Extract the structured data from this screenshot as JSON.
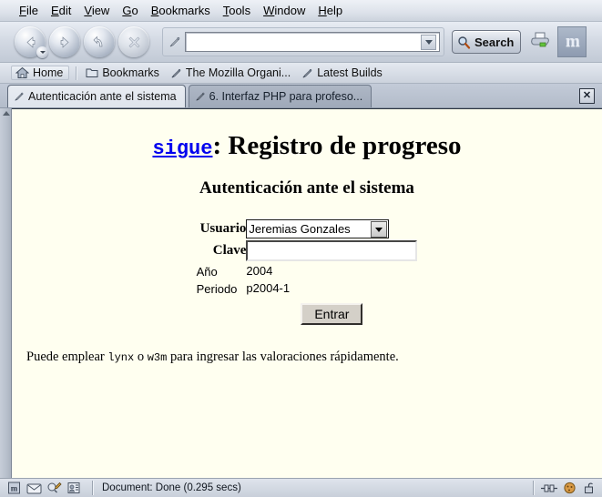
{
  "browser": {
    "menu": [
      {
        "mnemonic": "F",
        "rest": "ile"
      },
      {
        "mnemonic": "E",
        "rest": "dit"
      },
      {
        "mnemonic": "V",
        "rest": "iew"
      },
      {
        "mnemonic": "G",
        "rest": "o"
      },
      {
        "mnemonic": "B",
        "rest": "ookmarks"
      },
      {
        "mnemonic": "T",
        "rest": "ools"
      },
      {
        "mnemonic": "W",
        "rest": "indow"
      },
      {
        "mnemonic": "H",
        "rest": "elp"
      }
    ],
    "toolbar": {
      "back_label": "Back",
      "forward_label": "Forward",
      "reload_label": "Reload",
      "stop_label": "Stop",
      "url_value": "",
      "url_placeholder": "",
      "search_label": "Search",
      "print_label": "Print",
      "logo_label": "m"
    },
    "bookmarks_toolbar": [
      {
        "label": "Home",
        "icon": "home-icon"
      },
      {
        "label": "Bookmarks",
        "icon": "folder-icon"
      },
      {
        "label": "The Mozilla Organi...",
        "icon": "bookmark-icon"
      },
      {
        "label": "Latest Builds",
        "icon": "bookmark-icon"
      }
    ],
    "tabs": [
      {
        "label": "Autenticación ante el sistema",
        "active": true
      },
      {
        "label": "6. Interfaz PHP para profeso...",
        "active": false
      }
    ],
    "tab_close_label": "✕",
    "statusbar": {
      "document_status": "Document: Done (0.295 secs)",
      "component_icons": [
        "browser-icon",
        "mail-icon",
        "composer-icon",
        "addressbook-icon"
      ],
      "right_icons": [
        "connection-icon",
        "cookie-icon",
        "unlocked-padlock-icon"
      ]
    }
  },
  "page": {
    "title_link": "sigue",
    "title_rest": ": Registro de progreso",
    "subtitle": "Autenticación ante el sistema",
    "form": {
      "usuario_label": "Usuario",
      "usuario_value": "Jeremias Gonzales",
      "clave_label": "Clave",
      "clave_value": "",
      "ano_label": "Año",
      "ano_value": "2004",
      "periodo_label": "Periodo",
      "periodo_value": "p2004-1",
      "submit_label": "Entrar"
    },
    "footnote": {
      "part1": "Puede emplear ",
      "code1": "lynx",
      "part2": " o ",
      "code2": "w3m",
      "part3": " para ingresar las valoraciones rápidamente."
    },
    "colors": {
      "page_background": "#fffff0",
      "link": "#0000ee",
      "text": "#000000"
    }
  }
}
